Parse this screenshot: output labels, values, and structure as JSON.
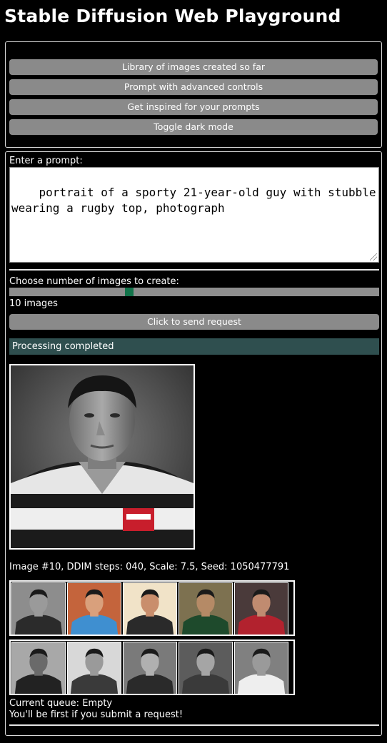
{
  "app": {
    "title": "Stable Diffusion Web Playground"
  },
  "nav": {
    "buttons": [
      "Library of images created so far",
      "Prompt with advanced controls",
      "Get inspired for your prompts",
      "Toggle dark mode"
    ]
  },
  "prompt": {
    "label": "Enter a prompt:",
    "value": "portrait of a sporty 21-year-old guy with stubble wearing a rugby top, photograph"
  },
  "images_count": {
    "label": "Choose number of images to create:",
    "value_text": "10 images",
    "slider_fraction": 0.32
  },
  "send": {
    "label": "Click to send request"
  },
  "status": {
    "text": "Processing completed"
  },
  "result": {
    "caption": "Image #10, DDIM steps: 040, Scale: 7.5, Seed: 1050477791"
  },
  "thumbnails": {
    "row1": [
      {
        "name": "thumb-1",
        "bg": "#8d8d8d",
        "shirt": "#2b2b2b",
        "skin": "#9a9a9a"
      },
      {
        "name": "thumb-2",
        "bg": "#c4643c",
        "shirt": "#3f8fd0",
        "skin": "#d9a07c"
      },
      {
        "name": "thumb-3",
        "bg": "#f1e3c8",
        "shirt": "#2a2a2a",
        "skin": "#c98e6c"
      },
      {
        "name": "thumb-4",
        "bg": "#7d7150",
        "shirt": "#1e4a2c",
        "skin": "#b58a66"
      },
      {
        "name": "thumb-5",
        "bg": "#4a3a3a",
        "shirt": "#b2222e",
        "skin": "#c08b70"
      }
    ],
    "row2": [
      {
        "name": "thumb-6",
        "bg": "#a8a8a8",
        "shirt": "#222222",
        "skin": "#6a6a6a"
      },
      {
        "name": "thumb-7",
        "bg": "#d8d8d8",
        "shirt": "#3a3a3a",
        "skin": "#9a9a9a"
      },
      {
        "name": "thumb-8",
        "bg": "#7a7a7a",
        "shirt": "#2a2a2a",
        "skin": "#b0b0b0"
      },
      {
        "name": "thumb-9",
        "bg": "#5c5c5c",
        "shirt": "#3a3a3a",
        "skin": "#a5a5a5"
      },
      {
        "name": "thumb-10",
        "bg": "#808080",
        "shirt": "#eeeeee",
        "skin": "#9a9a9a"
      }
    ]
  },
  "queue": {
    "line1": "Current queue: Empty",
    "line2": "You'll be first if you submit a request!"
  }
}
